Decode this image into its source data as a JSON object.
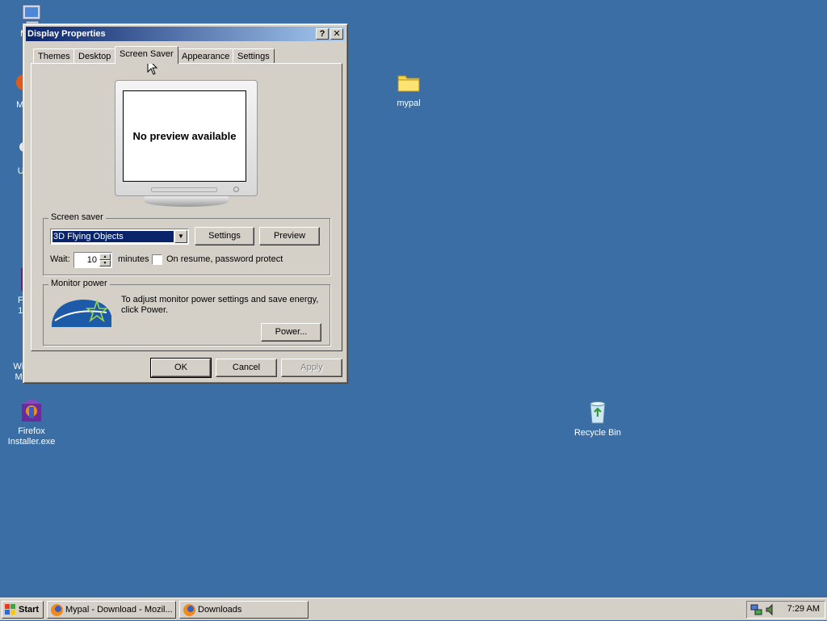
{
  "desktop": {
    "icons": [
      {
        "label": "My C"
      },
      {
        "label": "Mozil"
      },
      {
        "label": "Untit"
      },
      {
        "label": "Firef 100."
      },
      {
        "label": "Windo Make"
      },
      {
        "label": "Firefox Installer.exe"
      },
      {
        "label": "mypal"
      },
      {
        "label": "Recycle Bin"
      }
    ]
  },
  "dialog": {
    "title": "Display Properties",
    "help_btn": "?",
    "close_btn": "✕",
    "tabs": [
      "Themes",
      "Desktop",
      "Screen Saver",
      "Appearance",
      "Settings"
    ],
    "active_tab": "Screen Saver",
    "preview_text": "No preview available",
    "screensaver": {
      "group_label": "Screen saver",
      "selected": "3D Flying Objects",
      "settings_btn": "Settings",
      "preview_btn": "Preview",
      "wait_label": "Wait:",
      "wait_value": "10",
      "minutes_label": "minutes",
      "password_label": "On resume, password protect"
    },
    "monitor_power": {
      "group_label": "Monitor power",
      "description": "To adjust monitor power settings and save energy, click Power.",
      "power_btn": "Power..."
    },
    "footer": {
      "ok": "OK",
      "cancel": "Cancel",
      "apply": "Apply"
    }
  },
  "taskbar": {
    "start": "Start",
    "tasks": [
      "Mypal - Download - Mozil...",
      "Downloads"
    ],
    "clock": "7:29 AM"
  },
  "colors": {
    "desktop": "#3a6ea5",
    "title_gradient_start": "#0a246a",
    "title_gradient_end": "#a6caf0",
    "face": "#d4d0c8"
  }
}
